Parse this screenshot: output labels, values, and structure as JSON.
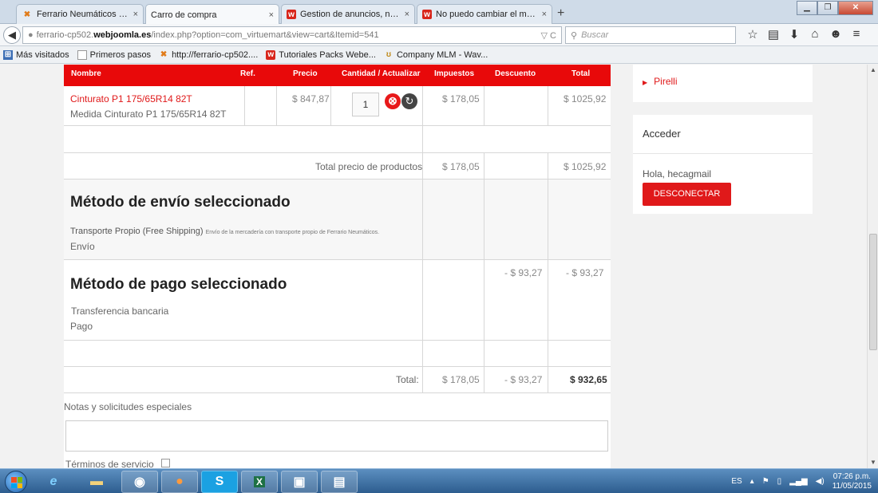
{
  "browser": {
    "tabs": [
      {
        "title": "Ferrario Neumáticos - Ad...",
        "icon": "joomla-icon",
        "active": false
      },
      {
        "title": "Carro de compra",
        "icon": "",
        "active": true
      },
      {
        "title": "Gestion de anuncios, no p...",
        "icon": "w-icon",
        "active": false
      },
      {
        "title": "No puedo cambiar el méto...",
        "icon": "w-icon",
        "active": false
      }
    ],
    "tab_close": "×",
    "new_tab": "+",
    "url_prefix": "ferrario-cp502.",
    "url_domain": "webjoomla.es",
    "url_rest": "/index.php?option=com_virtuemart&view=cart&Itemid=541",
    "url_icons": "▽ C",
    "search_placeholder": "Buscar",
    "bookmarks": [
      {
        "label": "Más visitados",
        "icon": "blue"
      },
      {
        "label": "Primeros pasos",
        "icon": "page"
      },
      {
        "label": "http://ferrario-cp502....",
        "icon": "joomla"
      },
      {
        "label": "Tutoriales Packs Webe...",
        "icon": "w"
      },
      {
        "label": "Company MLM - Wav...",
        "icon": "mlm"
      }
    ]
  },
  "cart": {
    "headers": {
      "nombre": "Nombre",
      "ref": "Ref.",
      "precio": "Precio",
      "cantidad": "Cantidad / Actualizar",
      "impuestos": "Impuestos",
      "descuento": "Descuento",
      "total": "Total"
    },
    "product": {
      "name": "Cinturato P1 175/65R14 82T",
      "measure": "Medida Cinturato P1 175/65R14 82T",
      "price": "$ 847,87",
      "qty": "1",
      "tax": "$ 178,05",
      "total": "$ 1025,92"
    },
    "subtotal": {
      "label": "Total precio de productos",
      "tax": "$ 178,05",
      "total": "$ 1025,92"
    },
    "shipping": {
      "heading": "Método de envío seleccionado",
      "method": "Transporte Propio (Free Shipping)",
      "description": "Envío de la mercadería con transporte propio de Ferrario Neumáticos.",
      "label": "Envío"
    },
    "payment": {
      "heading": "Método de pago seleccionado",
      "method": "Transferencia bancaria",
      "label": "Pago",
      "discount": "- $ 93,27",
      "total": "- $ 93,27"
    },
    "grand": {
      "label": "Total:",
      "tax": "$ 178,05",
      "discount": "- $ 93,27",
      "total": "$ 932,65"
    },
    "notes_label": "Notas y solicitudes especiales",
    "terms_label": "Términos de servicio"
  },
  "sidebar": {
    "pirelli": "Pirelli",
    "login_title": "Acceder",
    "greeting": "Hola, hecagmail",
    "logout": "DESCONECTAR"
  },
  "taskbar": {
    "lang": "ES",
    "time": "07:26 p.m.",
    "date": "11/05/2015"
  },
  "colors": {
    "accent_red": "#e8090a",
    "link_red": "#e0191a"
  }
}
